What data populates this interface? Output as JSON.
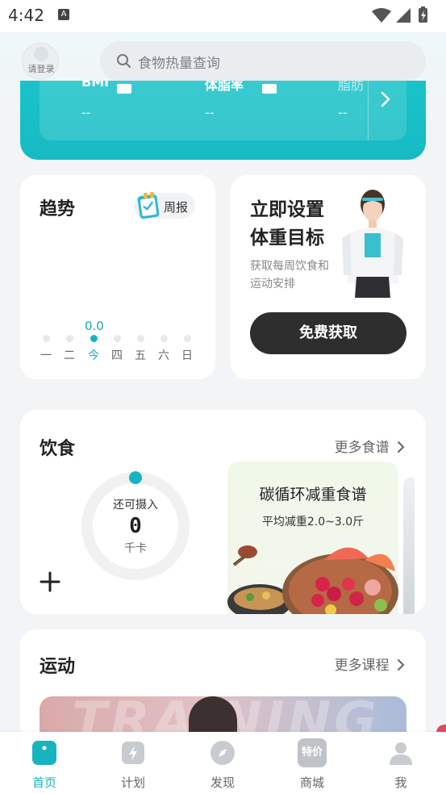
{
  "status_bar": {
    "time": "4:42",
    "notif_icon": "A"
  },
  "header": {
    "login_label": "请登录",
    "search_placeholder": "食物热量查询"
  },
  "banner": {
    "metrics": [
      {
        "label": "BMI",
        "value": "--"
      },
      {
        "label": "体脂率",
        "value": "--"
      },
      {
        "label": "脂肪",
        "value": "--"
      }
    ]
  },
  "trend": {
    "title": "趋势",
    "weekly_label": "周报",
    "today_value": "0.0",
    "days": [
      "一",
      "二",
      "今",
      "四",
      "五",
      "六",
      "日"
    ],
    "active_index": 2
  },
  "goal": {
    "title_line1": "立即设置",
    "title_line2": "体重目标",
    "sub_line1": "获取每周饮食和",
    "sub_line2": "运动安排",
    "button": "免费获取"
  },
  "diet": {
    "title": "饮食",
    "more": "更多食谱",
    "ring_label": "还可摄入",
    "ring_value": "0",
    "ring_unit": "千卡",
    "recipe_title": "碳循环减重食谱",
    "recipe_sub": "平均减重2.0~3.0斤"
  },
  "sport": {
    "title": "运动",
    "more": "更多课程",
    "watermark": "TRAINING"
  },
  "tabbar": {
    "items": [
      {
        "label": "首页",
        "icon": "home-icon",
        "active": true
      },
      {
        "label": "计划",
        "icon": "plan-icon",
        "active": false
      },
      {
        "label": "发现",
        "icon": "compass-icon",
        "active": false
      },
      {
        "label": "商城",
        "icon": "shop-icon",
        "badge": "特价",
        "active": false
      },
      {
        "label": "我",
        "icon": "profile-icon",
        "active": false
      }
    ]
  },
  "colors": {
    "accent": "#19b3c0",
    "banner": "#19c3c9",
    "button_dark": "#2e2e2e"
  }
}
